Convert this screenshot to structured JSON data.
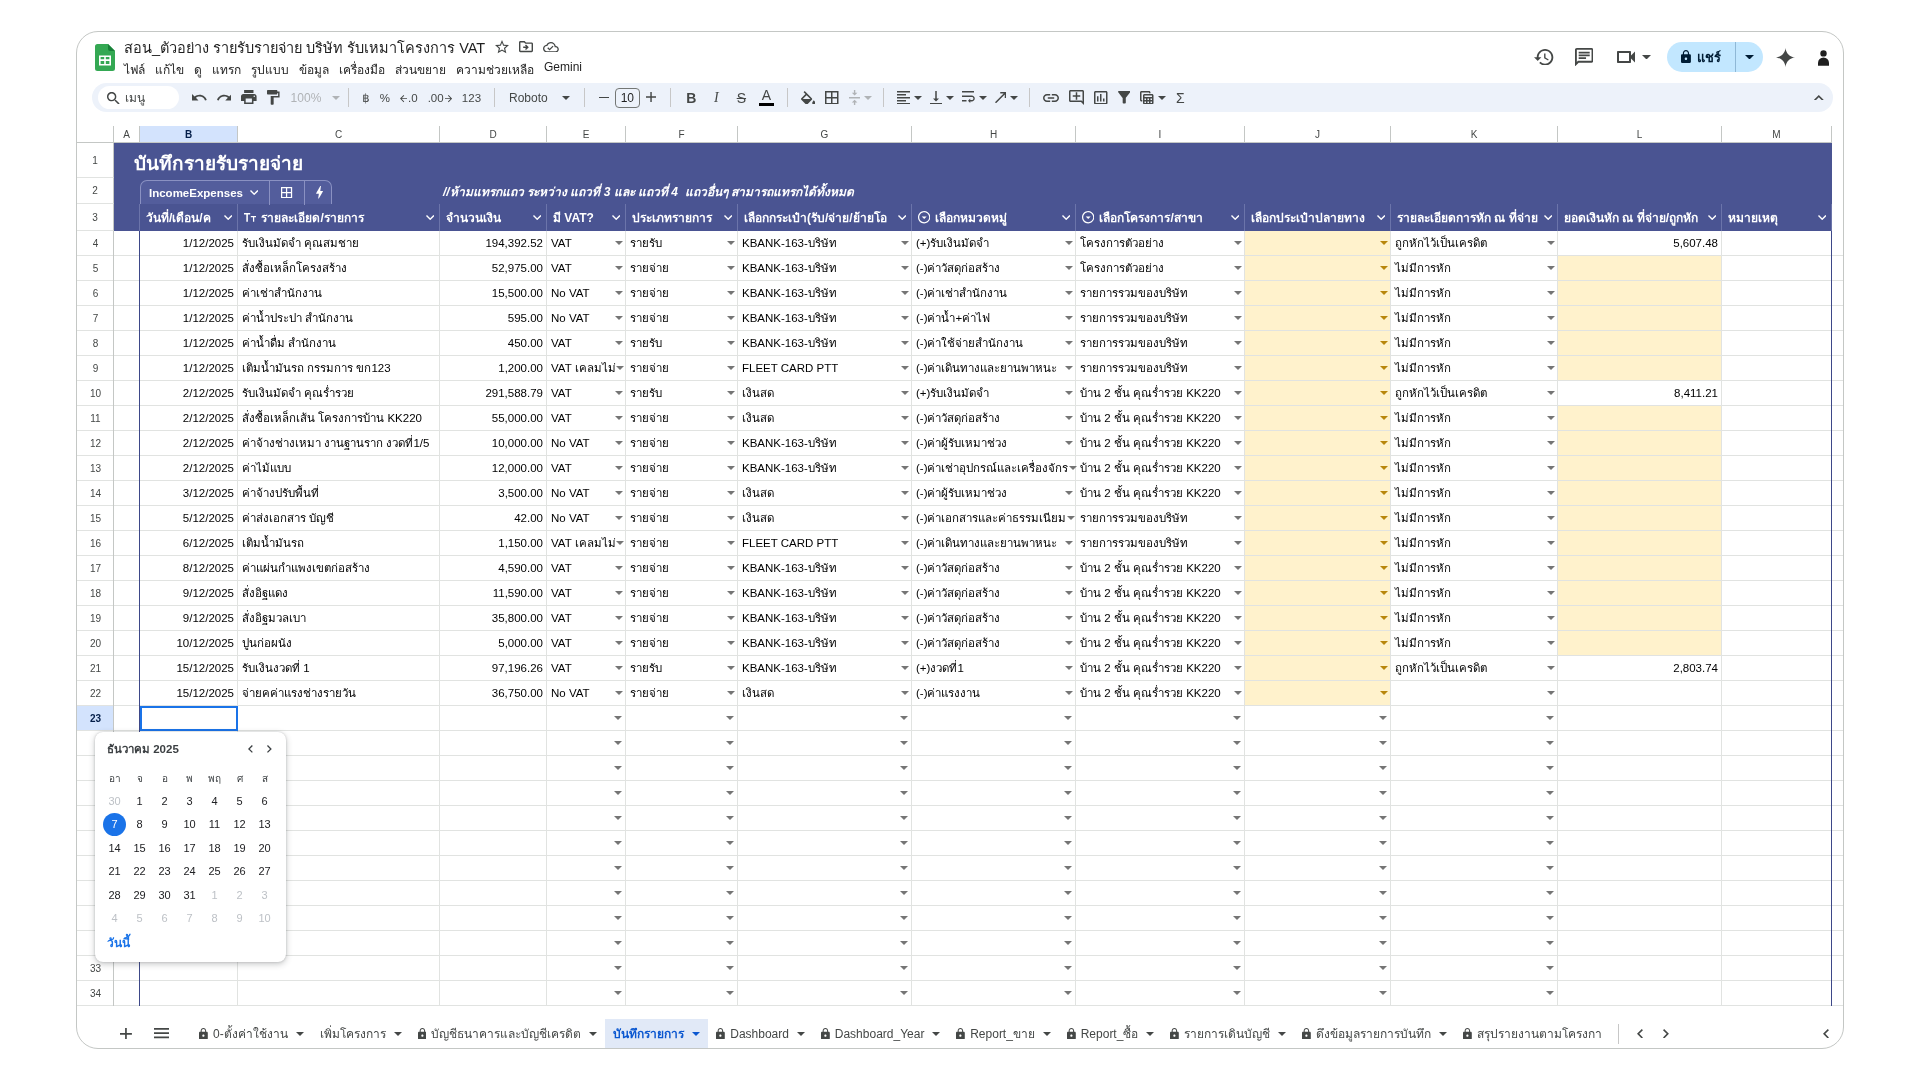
{
  "header": {
    "title": "สอน_ตัวอย่าง รายรับรายจ่าย บริษัท รับเหมาโครงการ VAT",
    "menus": [
      "ไฟล์",
      "แก้ไข",
      "ดู",
      "แทรก",
      "รูปแบบ",
      "ข้อมูล",
      "เครื่องมือ",
      "ส่วนขยาย",
      "ความช่วยเหลือ",
      "Gemini"
    ],
    "share": "แชร์"
  },
  "toolbar": {
    "search": {
      "placeholder": "เมนู"
    },
    "zoom": {
      "value": "100%",
      "disabled": true
    },
    "formats": [
      "฿",
      "%",
      ".0",
      ".00",
      "123"
    ],
    "font": "Roboto",
    "font_size": "10",
    "styles": [
      "B",
      "I",
      "S",
      "A"
    ],
    "merge": {
      "disabled": true
    },
    "functions": "Σ"
  },
  "column_letters": [
    {
      "label": "A",
      "selected": false
    },
    {
      "label": "B",
      "selected": true
    },
    {
      "label": "C",
      "selected": false
    },
    {
      "label": "D",
      "selected": false
    },
    {
      "label": "E",
      "selected": false
    },
    {
      "label": "F",
      "selected": false
    },
    {
      "label": "G",
      "selected": false
    },
    {
      "label": "H",
      "selected": false
    },
    {
      "label": "I",
      "selected": false
    },
    {
      "label": "J",
      "selected": false
    },
    {
      "label": "K",
      "selected": false
    },
    {
      "label": "L",
      "selected": false
    },
    {
      "label": "M",
      "selected": false
    }
  ],
  "table": {
    "title": "บันทึกรายรับรายจ่าย",
    "name": "IncomeExpenses",
    "note": "//ห้ามแทรกแถว ระหว่าง แถวที่ 3 และ แถวที่ 4  แถวอื่นๆ สามารถแทรกได้ทั้งหมด",
    "header_rows": [
      {
        "number": "1",
        "selected": false
      },
      {
        "number": "2",
        "selected": false
      },
      {
        "number": "3",
        "selected": false
      }
    ],
    "columns": [
      {
        "header": "วันที่/เดือน/ค",
        "kind": "date"
      },
      {
        "header": "รายละเอียด/รายการ",
        "kind": "text"
      },
      {
        "header": "จำนวนเงิน",
        "kind": "number"
      },
      {
        "header": "มี VAT?",
        "kind": "dropdown"
      },
      {
        "header": "ประเภทรายการ",
        "kind": "dropdown"
      },
      {
        "header": "เลือกกระเป๋า(รับ/จ่าย/ย้ายโอ",
        "kind": "dropdown"
      },
      {
        "header": "เลือกหมวดหมู่",
        "kind": "dropdown"
      },
      {
        "header": "เลือกโครงการ/สาขา",
        "kind": "dropdown"
      },
      {
        "header": "เลือกประเป๋าปลายทาง",
        "kind": "dropdown"
      },
      {
        "header": "รายละเอียดการหัก ณ ที่จ่าย",
        "kind": "dropdown"
      },
      {
        "header": "ยอดเงินหัก ณ ที่จ่าย/ถูกหัก",
        "kind": "number"
      },
      {
        "header": "หมายเหตุ",
        "kind": "text"
      }
    ],
    "rows": [
      {
        "number": "4",
        "selected": false,
        "cells": [
          {
            "text": "1/12/2025",
            "highlight": false
          },
          {
            "text": "รับเงินมัดจำ คุณสมชาย",
            "highlight": false
          },
          {
            "text": "194,392.52",
            "highlight": false
          },
          {
            "text": "VAT",
            "highlight": false
          },
          {
            "text": "รายรับ",
            "highlight": false
          },
          {
            "text": "KBANK-163-บริษัท",
            "highlight": false
          },
          {
            "text": "(+)รับเงินมัดจำ",
            "highlight": false
          },
          {
            "text": "โครงการตัวอย่าง",
            "highlight": false
          },
          {
            "highlight": true
          },
          {
            "text": "ถูกหักไว้เป็นเครดิต",
            "highlight": false
          },
          {
            "text": "5,607.48",
            "highlight": false
          },
          {
            "highlight": false
          }
        ]
      },
      {
        "number": "5",
        "selected": false,
        "cells": [
          {
            "text": "1/12/2025",
            "highlight": false
          },
          {
            "text": "สั่งซื้อเหล็กโครงสร้าง",
            "highlight": false
          },
          {
            "text": "52,975.00",
            "highlight": false
          },
          {
            "text": "VAT",
            "highlight": false
          },
          {
            "text": "รายจ่าย",
            "highlight": false
          },
          {
            "text": "KBANK-163-บริษัท",
            "highlight": false
          },
          {
            "text": "(-)ค่าวัสดุก่อสร้าง",
            "highlight": false
          },
          {
            "text": "โครงการตัวอย่าง",
            "highlight": false
          },
          {
            "highlight": true
          },
          {
            "text": "ไม่มีการหัก",
            "highlight": false
          },
          {
            "highlight": true
          },
          {
            "highlight": false
          }
        ]
      },
      {
        "number": "6",
        "selected": false,
        "cells": [
          {
            "text": "1/12/2025",
            "highlight": false
          },
          {
            "text": "ค่าเช่าสำนักงาน",
            "highlight": false
          },
          {
            "text": "15,500.00",
            "highlight": false
          },
          {
            "text": "No VAT",
            "highlight": false
          },
          {
            "text": "รายจ่าย",
            "highlight": false
          },
          {
            "text": "KBANK-163-บริษัท",
            "highlight": false
          },
          {
            "text": "(-)ค่าเช่าสำนักงาน",
            "highlight": false
          },
          {
            "text": "รายการรวมของบริษัท",
            "highlight": false
          },
          {
            "highlight": true
          },
          {
            "text": "ไม่มีการหัก",
            "highlight": false
          },
          {
            "highlight": true
          },
          {
            "highlight": false
          }
        ]
      },
      {
        "number": "7",
        "selected": false,
        "cells": [
          {
            "text": "1/12/2025",
            "highlight": false
          },
          {
            "text": "ค่าน้ำประปา สำนักงาน",
            "highlight": false
          },
          {
            "text": "595.00",
            "highlight": false
          },
          {
            "text": "No VAT",
            "highlight": false
          },
          {
            "text": "รายจ่าย",
            "highlight": false
          },
          {
            "text": "KBANK-163-บริษัท",
            "highlight": false
          },
          {
            "text": "(-)ค่าน้ำ+ค่าไฟ",
            "highlight": false
          },
          {
            "text": "รายการรวมของบริษัท",
            "highlight": false
          },
          {
            "highlight": true
          },
          {
            "text": "ไม่มีการหัก",
            "highlight": false
          },
          {
            "highlight": true
          },
          {
            "highlight": false
          }
        ]
      },
      {
        "number": "8",
        "selected": false,
        "cells": [
          {
            "text": "1/12/2025",
            "highlight": false
          },
          {
            "text": "ค่าน้ำดื่ม สำนักงาน",
            "highlight": false
          },
          {
            "text": "450.00",
            "highlight": false
          },
          {
            "text": "VAT",
            "highlight": false
          },
          {
            "text": "รายรับ",
            "highlight": false
          },
          {
            "text": "KBANK-163-บริษัท",
            "highlight": false
          },
          {
            "text": "(-)ค่าใช้จ่ายสำนักงาน",
            "highlight": false
          },
          {
            "text": "รายการรวมของบริษัท",
            "highlight": false
          },
          {
            "highlight": true
          },
          {
            "text": "ไม่มีการหัก",
            "highlight": false
          },
          {
            "highlight": true
          },
          {
            "highlight": false
          }
        ]
      },
      {
        "number": "9",
        "selected": false,
        "cells": [
          {
            "text": "1/12/2025",
            "highlight": false
          },
          {
            "text": "เติมน้ำมันรถ กรรมการ ขก123",
            "highlight": false
          },
          {
            "text": "1,200.00",
            "highlight": false
          },
          {
            "text": "VAT เคลมไม่",
            "highlight": false
          },
          {
            "text": "รายจ่าย",
            "highlight": false
          },
          {
            "text": "FLEET CARD PTT",
            "highlight": false
          },
          {
            "text": "(-)ค่าเดินทางและยานพาหนะ",
            "highlight": false
          },
          {
            "text": "รายการรวมของบริษัท",
            "highlight": false
          },
          {
            "highlight": true
          },
          {
            "text": "ไม่มีการหัก",
            "highlight": false
          },
          {
            "highlight": true
          },
          {
            "highlight": false
          }
        ]
      },
      {
        "number": "10",
        "selected": false,
        "cells": [
          {
            "text": "2/12/2025",
            "highlight": false
          },
          {
            "text": "รับเงินมัดจำ คุณร่ำรวย",
            "highlight": false
          },
          {
            "text": "291,588.79",
            "highlight": false
          },
          {
            "text": "VAT",
            "highlight": false
          },
          {
            "text": "รายรับ",
            "highlight": false
          },
          {
            "text": "เงินสด",
            "highlight": false
          },
          {
            "text": "(+)รับเงินมัดจำ",
            "highlight": false
          },
          {
            "text": "บ้าน 2 ชั้น คุณร่ำรวย KK220",
            "highlight": false
          },
          {
            "highlight": true
          },
          {
            "text": "ถูกหักไว้เป็นเครดิต",
            "highlight": false
          },
          {
            "text": "8,411.21",
            "highlight": false
          },
          {
            "highlight": false
          }
        ]
      },
      {
        "number": "11",
        "selected": false,
        "cells": [
          {
            "text": "2/12/2025",
            "highlight": false
          },
          {
            "text": "สั่งซื้อเหล็กเส้น โครงการบ้าน KK220",
            "highlight": false
          },
          {
            "text": "55,000.00",
            "highlight": false
          },
          {
            "text": "VAT",
            "highlight": false
          },
          {
            "text": "รายจ่าย",
            "highlight": false
          },
          {
            "text": "เงินสด",
            "highlight": false
          },
          {
            "text": "(-)ค่าวัสดุก่อสร้าง",
            "highlight": false
          },
          {
            "text": "บ้าน 2 ชั้น คุณร่ำรวย KK220",
            "highlight": false
          },
          {
            "highlight": true
          },
          {
            "text": "ไม่มีการหัก",
            "highlight": false
          },
          {
            "highlight": true
          },
          {
            "highlight": false
          }
        ]
      },
      {
        "number": "12",
        "selected": false,
        "cells": [
          {
            "text": "2/12/2025",
            "highlight": false
          },
          {
            "text": "ค่าจ้างช่างเหมา งานฐานราก งวดที่1/5",
            "highlight": false
          },
          {
            "text": "10,000.00",
            "highlight": false
          },
          {
            "text": "No VAT",
            "highlight": false
          },
          {
            "text": "รายจ่าย",
            "highlight": false
          },
          {
            "text": "KBANK-163-บริษัท",
            "highlight": false
          },
          {
            "text": "(-)ค่าผู้รับเหมาช่วง",
            "highlight": false
          },
          {
            "text": "บ้าน 2 ชั้น คุณร่ำรวย KK220",
            "highlight": false
          },
          {
            "highlight": true
          },
          {
            "text": "ไม่มีการหัก",
            "highlight": false
          },
          {
            "highlight": true
          },
          {
            "highlight": false
          }
        ]
      },
      {
        "number": "13",
        "selected": false,
        "cells": [
          {
            "text": "2/12/2025",
            "highlight": false
          },
          {
            "text": "ค่าไม้แบบ",
            "highlight": false
          },
          {
            "text": "12,000.00",
            "highlight": false
          },
          {
            "text": "VAT",
            "highlight": false
          },
          {
            "text": "รายจ่าย",
            "highlight": false
          },
          {
            "text": "KBANK-163-บริษัท",
            "highlight": false
          },
          {
            "text": "(-)ค่าเช่าอุปกรณ์และเครื่องจักร",
            "highlight": false
          },
          {
            "text": "บ้าน 2 ชั้น คุณร่ำรวย KK220",
            "highlight": false
          },
          {
            "highlight": true
          },
          {
            "text": "ไม่มีการหัก",
            "highlight": false
          },
          {
            "highlight": true
          },
          {
            "highlight": false
          }
        ]
      },
      {
        "number": "14",
        "selected": false,
        "cells": [
          {
            "text": "3/12/2025",
            "highlight": false
          },
          {
            "text": "ค่าจ้างปรับพื้นที่",
            "highlight": false
          },
          {
            "text": "3,500.00",
            "highlight": false
          },
          {
            "text": "No VAT",
            "highlight": false
          },
          {
            "text": "รายจ่าย",
            "highlight": false
          },
          {
            "text": "เงินสด",
            "highlight": false
          },
          {
            "text": "(-)ค่าผู้รับเหมาช่วง",
            "highlight": false
          },
          {
            "text": "บ้าน 2 ชั้น คุณร่ำรวย KK220",
            "highlight": false
          },
          {
            "highlight": true
          },
          {
            "text": "ไม่มีการหัก",
            "highlight": false
          },
          {
            "highlight": true
          },
          {
            "highlight": false
          }
        ]
      },
      {
        "number": "15",
        "selected": false,
        "cells": [
          {
            "text": "5/12/2025",
            "highlight": false
          },
          {
            "text": "ค่าส่งเอกสาร บัญชี",
            "highlight": false
          },
          {
            "text": "42.00",
            "highlight": false
          },
          {
            "text": "No VAT",
            "highlight": false
          },
          {
            "text": "รายจ่าย",
            "highlight": false
          },
          {
            "text": "เงินสด",
            "highlight": false
          },
          {
            "text": "(-)ค่าเอกสารและค่าธรรมเนียม",
            "highlight": false
          },
          {
            "text": "รายการรวมของบริษัท",
            "highlight": false
          },
          {
            "highlight": true
          },
          {
            "text": "ไม่มีการหัก",
            "highlight": false
          },
          {
            "highlight": true
          },
          {
            "highlight": false
          }
        ]
      },
      {
        "number": "16",
        "selected": false,
        "cells": [
          {
            "text": "6/12/2025",
            "highlight": false
          },
          {
            "text": "เติมน้ำมันรถ",
            "highlight": false
          },
          {
            "text": "1,150.00",
            "highlight": false
          },
          {
            "text": "VAT เคลมไม่",
            "highlight": false
          },
          {
            "text": "รายจ่าย",
            "highlight": false
          },
          {
            "text": "FLEET CARD PTT",
            "highlight": false
          },
          {
            "text": "(-)ค่าเดินทางและยานพาหนะ",
            "highlight": false
          },
          {
            "text": "รายการรวมของบริษัท",
            "highlight": false
          },
          {
            "highlight": true
          },
          {
            "text": "ไม่มีการหัก",
            "highlight": false
          },
          {
            "highlight": true
          },
          {
            "highlight": false
          }
        ]
      },
      {
        "number": "17",
        "selected": false,
        "cells": [
          {
            "text": "8/12/2025",
            "highlight": false
          },
          {
            "text": "ค่าแผ่นกำแพงเขตก่อสร้าง",
            "highlight": false
          },
          {
            "text": "4,590.00",
            "highlight": false
          },
          {
            "text": "VAT",
            "highlight": false
          },
          {
            "text": "รายจ่าย",
            "highlight": false
          },
          {
            "text": "KBANK-163-บริษัท",
            "highlight": false
          },
          {
            "text": "(-)ค่าวัสดุก่อสร้าง",
            "highlight": false
          },
          {
            "text": "บ้าน 2 ชั้น คุณร่ำรวย KK220",
            "highlight": false
          },
          {
            "highlight": true
          },
          {
            "text": "ไม่มีการหัก",
            "highlight": false
          },
          {
            "highlight": true
          },
          {
            "highlight": false
          }
        ]
      },
      {
        "number": "18",
        "selected": false,
        "cells": [
          {
            "text": "9/12/2025",
            "highlight": false
          },
          {
            "text": "สั่งอิฐแดง",
            "highlight": false
          },
          {
            "text": "11,590.00",
            "highlight": false
          },
          {
            "text": "VAT",
            "highlight": false
          },
          {
            "text": "รายจ่าย",
            "highlight": false
          },
          {
            "text": "KBANK-163-บริษัท",
            "highlight": false
          },
          {
            "text": "(-)ค่าวัสดุก่อสร้าง",
            "highlight": false
          },
          {
            "text": "บ้าน 2 ชั้น คุณร่ำรวย KK220",
            "highlight": false
          },
          {
            "highlight": true
          },
          {
            "text": "ไม่มีการหัก",
            "highlight": false
          },
          {
            "highlight": true
          },
          {
            "highlight": false
          }
        ]
      },
      {
        "number": "19",
        "selected": false,
        "cells": [
          {
            "text": "9/12/2025",
            "highlight": false
          },
          {
            "text": "สั่งอิฐมวลเบา",
            "highlight": false
          },
          {
            "text": "35,800.00",
            "highlight": false
          },
          {
            "text": "VAT",
            "highlight": false
          },
          {
            "text": "รายจ่าย",
            "highlight": false
          },
          {
            "text": "KBANK-163-บริษัท",
            "highlight": false
          },
          {
            "text": "(-)ค่าวัสดุก่อสร้าง",
            "highlight": false
          },
          {
            "text": "บ้าน 2 ชั้น คุณร่ำรวย KK220",
            "highlight": false
          },
          {
            "highlight": true
          },
          {
            "text": "ไม่มีการหัก",
            "highlight": false
          },
          {
            "highlight": true
          },
          {
            "highlight": false
          }
        ]
      },
      {
        "number": "20",
        "selected": false,
        "cells": [
          {
            "text": "10/12/2025",
            "highlight": false
          },
          {
            "text": "ปูนก่อผนัง",
            "highlight": false
          },
          {
            "text": "5,000.00",
            "highlight": false
          },
          {
            "text": "VAT",
            "highlight": false
          },
          {
            "text": "รายจ่าย",
            "highlight": false
          },
          {
            "text": "KBANK-163-บริษัท",
            "highlight": false
          },
          {
            "text": "(-)ค่าวัสดุก่อสร้าง",
            "highlight": false
          },
          {
            "text": "บ้าน 2 ชั้น คุณร่ำรวย KK220",
            "highlight": false
          },
          {
            "highlight": true
          },
          {
            "text": "ไม่มีการหัก",
            "highlight": false
          },
          {
            "highlight": true
          },
          {
            "highlight": false
          }
        ]
      },
      {
        "number": "21",
        "selected": false,
        "cells": [
          {
            "text": "15/12/2025",
            "highlight": false
          },
          {
            "text": "รับเงินงวดที่ 1",
            "highlight": false
          },
          {
            "text": "97,196.26",
            "highlight": false
          },
          {
            "text": "VAT",
            "highlight": false
          },
          {
            "text": "รายรับ",
            "highlight": false
          },
          {
            "text": "KBANK-163-บริษัท",
            "highlight": false
          },
          {
            "text": "(+)งวดที่1",
            "highlight": false
          },
          {
            "text": "บ้าน 2 ชั้น คุณร่ำรวย KK220",
            "highlight": false
          },
          {
            "highlight": true
          },
          {
            "text": "ถูกหักไว้เป็นเครดิต",
            "highlight": false
          },
          {
            "text": "2,803.74",
            "highlight": false
          },
          {
            "highlight": false
          }
        ]
      },
      {
        "number": "22",
        "selected": false,
        "cells": [
          {
            "text": "15/12/2025",
            "highlight": false
          },
          {
            "text": "จ่ายคค่าแรงช่างรายวัน",
            "highlight": false
          },
          {
            "text": "36,750.00",
            "highlight": false
          },
          {
            "text": "No VAT",
            "highlight": false
          },
          {
            "text": "รายจ่าย",
            "highlight": false
          },
          {
            "text": "เงินสด",
            "highlight": false
          },
          {
            "text": "(-)ค่าแรงงาน",
            "highlight": false
          },
          {
            "text": "บ้าน 2 ชั้น คุณร่ำรวย KK220",
            "highlight": false
          },
          {
            "highlight": true
          },
          {
            "highlight": false
          },
          {
            "highlight": false
          },
          {
            "highlight": false
          }
        ]
      }
    ],
    "empty_rows": [
      {
        "number": "23",
        "selected": true
      },
      {
        "selected": false
      },
      {
        "selected": false
      },
      {
        "selected": false
      },
      {
        "selected": false
      },
      {
        "selected": false
      },
      {
        "selected": false
      },
      {
        "selected": false
      },
      {
        "selected": false
      },
      {
        "selected": false
      },
      {
        "number": "33",
        "selected": false
      },
      {
        "number": "34",
        "selected": false
      }
    ]
  },
  "calendar": {
    "month": "ธันวาคม 2025",
    "weekdays": [
      "อา",
      "จ",
      "อ",
      "พ",
      "พฤ",
      "ศ",
      "ส"
    ],
    "weeks": [
      [
        {
          "day": "30",
          "in_month": false,
          "selected": false
        },
        {
          "day": "1",
          "in_month": true,
          "selected": false
        },
        {
          "day": "2",
          "in_month": true,
          "selected": false
        },
        {
          "day": "3",
          "in_month": true,
          "selected": false
        },
        {
          "day": "4",
          "in_month": true,
          "selected": false
        },
        {
          "day": "5",
          "in_month": true,
          "selected": false
        },
        {
          "day": "6",
          "in_month": true,
          "selected": false
        }
      ],
      [
        {
          "day": "7",
          "in_month": true,
          "selected": true
        },
        {
          "day": "8",
          "in_month": true,
          "selected": false
        },
        {
          "day": "9",
          "in_month": true,
          "selected": false
        },
        {
          "day": "10",
          "in_month": true,
          "selected": false
        },
        {
          "day": "11",
          "in_month": true,
          "selected": false
        },
        {
          "day": "12",
          "in_month": true,
          "selected": false
        },
        {
          "day": "13",
          "in_month": true,
          "selected": false
        }
      ],
      [
        {
          "day": "14",
          "in_month": true,
          "selected": false
        },
        {
          "day": "15",
          "in_month": true,
          "selected": false
        },
        {
          "day": "16",
          "in_month": true,
          "selected": false
        },
        {
          "day": "17",
          "in_month": true,
          "selected": false
        },
        {
          "day": "18",
          "in_month": true,
          "selected": false
        },
        {
          "day": "19",
          "in_month": true,
          "selected": false
        },
        {
          "day": "20",
          "in_month": true,
          "selected": false
        }
      ],
      [
        {
          "day": "21",
          "in_month": true,
          "selected": false
        },
        {
          "day": "22",
          "in_month": true,
          "selected": false
        },
        {
          "day": "23",
          "in_month": true,
          "selected": false
        },
        {
          "day": "24",
          "in_month": true,
          "selected": false
        },
        {
          "day": "25",
          "in_month": true,
          "selected": false
        },
        {
          "day": "26",
          "in_month": true,
          "selected": false
        },
        {
          "day": "27",
          "in_month": true,
          "selected": false
        }
      ],
      [
        {
          "day": "28",
          "in_month": true,
          "selected": false
        },
        {
          "day": "29",
          "in_month": true,
          "selected": false
        },
        {
          "day": "30",
          "in_month": true,
          "selected": false
        },
        {
          "day": "31",
          "in_month": true,
          "selected": false
        },
        {
          "day": "1",
          "in_month": false,
          "selected": false
        },
        {
          "day": "2",
          "in_month": false,
          "selected": false
        },
        {
          "day": "3",
          "in_month": false,
          "selected": false
        }
      ],
      [
        {
          "day": "4",
          "in_month": false,
          "selected": false
        },
        {
          "day": "5",
          "in_month": false,
          "selected": false
        },
        {
          "day": "6",
          "in_month": false,
          "selected": false
        },
        {
          "day": "7",
          "in_month": false,
          "selected": false
        },
        {
          "day": "8",
          "in_month": false,
          "selected": false
        },
        {
          "day": "9",
          "in_month": false,
          "selected": false
        },
        {
          "day": "10",
          "in_month": false,
          "selected": false
        }
      ]
    ],
    "today": "วันนี้"
  },
  "sheet_tabs": [
    {
      "label": "0-ตั้งค่าใช้งาน",
      "locked": true,
      "selected": false
    },
    {
      "label": "เพิ่มโครงการ",
      "locked": false,
      "selected": false
    },
    {
      "label": "บัญชีธนาคารและบัญชีเครดิต",
      "locked": true,
      "selected": false
    },
    {
      "label": "บันทึกรายการ",
      "locked": false,
      "selected": true
    },
    {
      "label": "Dashboard",
      "locked": true,
      "selected": false
    },
    {
      "label": "Dashboard_Year",
      "locked": true,
      "selected": false
    },
    {
      "label": "Report_ขาย",
      "locked": true,
      "selected": false
    },
    {
      "label": "Report_ซื้อ",
      "locked": true,
      "selected": false
    },
    {
      "label": "รายการเดินบัญชี",
      "locked": true,
      "selected": false
    },
    {
      "label": "ดึงข้อมูลรายการบันทึก",
      "locked": true,
      "selected": false
    },
    {
      "label": "สรุปรายงานตามโครงกา",
      "locked": true,
      "selected": false
    }
  ]
}
